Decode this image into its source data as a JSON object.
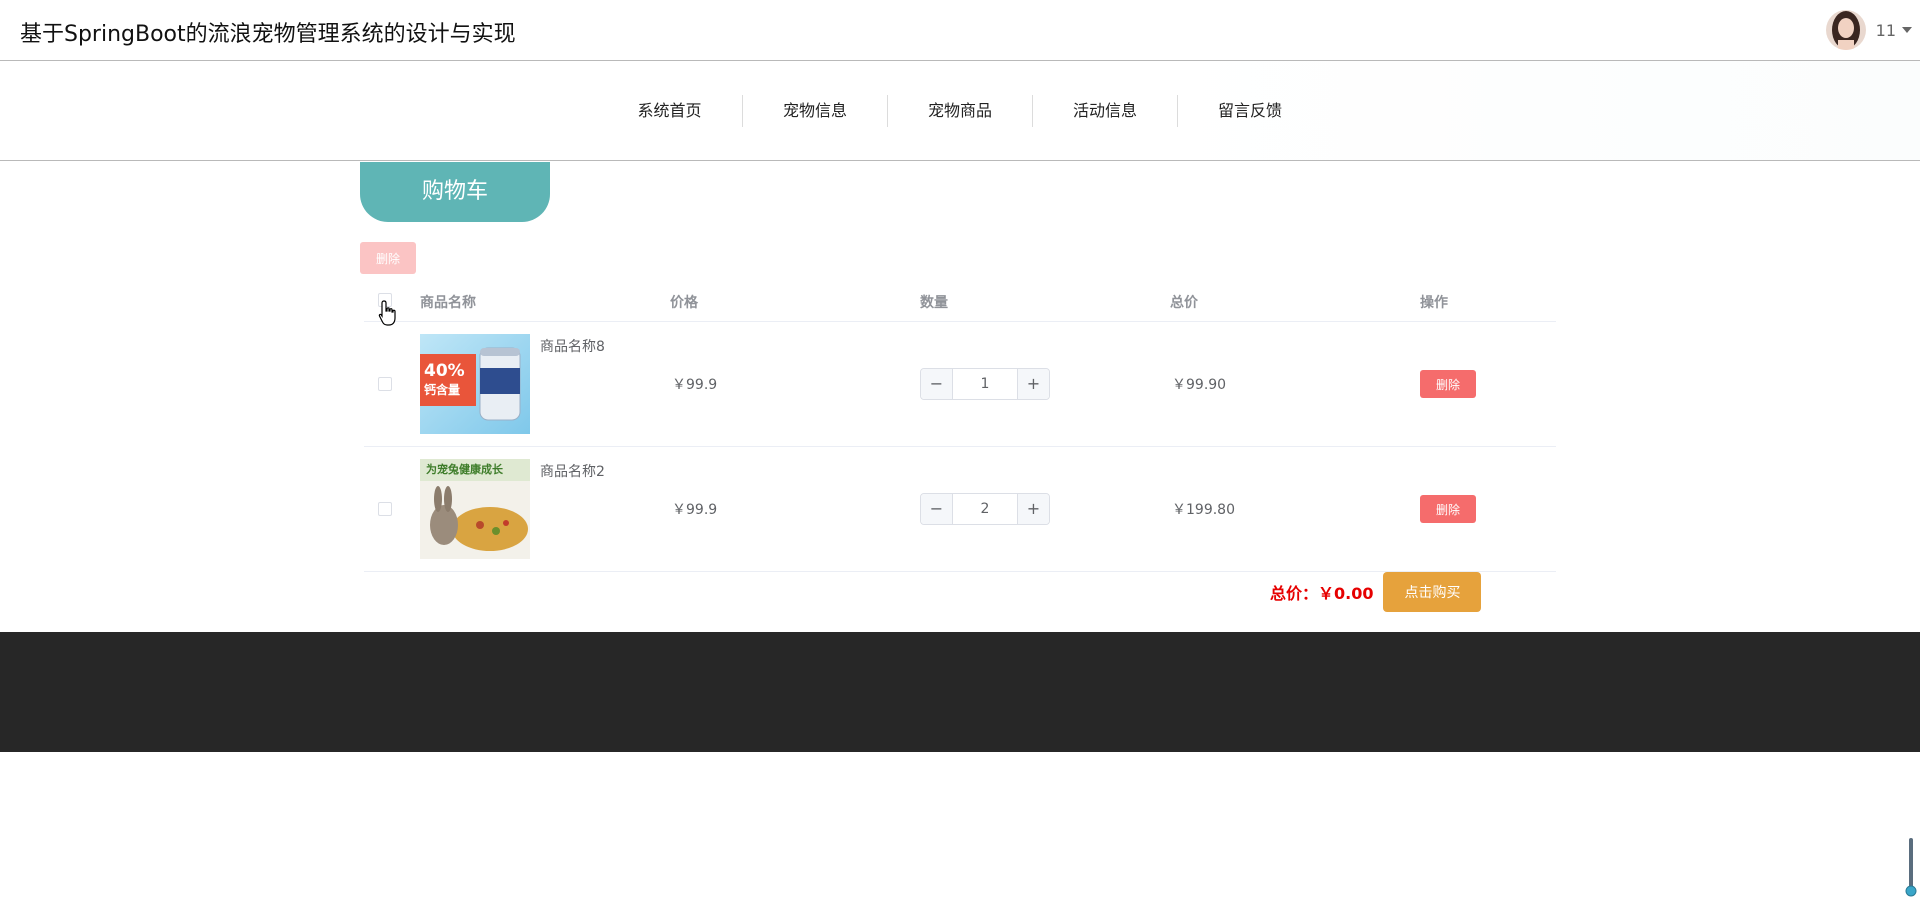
{
  "header": {
    "title": "基于SpringBoot的流浪宠物管理系统的设计与实现",
    "username": "11"
  },
  "nav": {
    "items": [
      {
        "label": "系统首页"
      },
      {
        "label": "宠物信息"
      },
      {
        "label": "宠物商品"
      },
      {
        "label": "活动信息"
      },
      {
        "label": "留言反馈"
      }
    ]
  },
  "cart": {
    "tab_label": "购物车",
    "bulk_delete_label": "删除",
    "columns": {
      "name": "商品名称",
      "price": "价格",
      "quantity": "数量",
      "subtotal": "总价",
      "action": "操作"
    },
    "rows": [
      {
        "name": "商品名称8",
        "price": "￥99.9",
        "quantity": "1",
        "subtotal": "￥99.90",
        "delete_label": "删除",
        "image_text": "40%",
        "image_text2": "钙含量"
      },
      {
        "name": "商品名称2",
        "price": "￥99.9",
        "quantity": "2",
        "subtotal": "￥199.80",
        "delete_label": "删除",
        "image_text": "为宠兔健康成长"
      }
    ],
    "total_label": "总价：￥0.00",
    "buy_label": "点击购买"
  },
  "colors": {
    "tab": "#5fb5b5",
    "delete": "#f56c6c",
    "buy": "#e6a23c",
    "total": "#e60000",
    "footer": "#272727"
  }
}
